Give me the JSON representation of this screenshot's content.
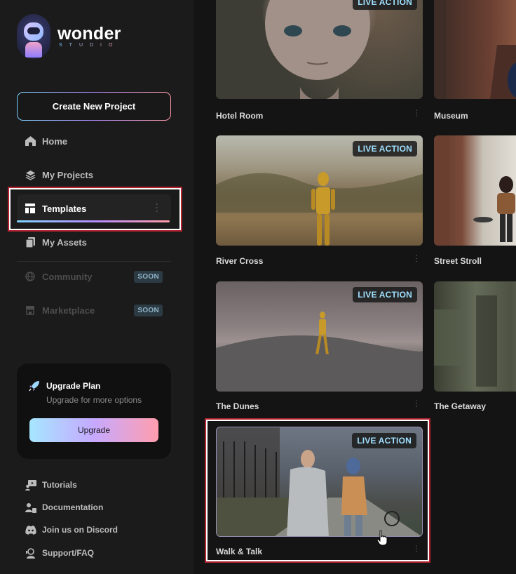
{
  "brand": {
    "name": "wonder",
    "sub": "STUDIO"
  },
  "sidebar": {
    "create_label": "Create New Project",
    "nav": [
      {
        "label": "Home",
        "icon": "home-icon"
      },
      {
        "label": "My Projects",
        "icon": "layers-icon"
      },
      {
        "label": "Templates",
        "icon": "template-icon",
        "active": true
      },
      {
        "label": "My Assets",
        "icon": "assets-icon"
      }
    ],
    "disabled_nav": [
      {
        "label": "Community",
        "badge": "SOON",
        "icon": "globe-icon"
      },
      {
        "label": "Marketplace",
        "badge": "SOON",
        "icon": "store-icon"
      }
    ],
    "upgrade": {
      "title": "Upgrade Plan",
      "subtitle": "Upgrade for more options",
      "button": "Upgrade"
    },
    "footer": [
      {
        "label": "Tutorials",
        "icon": "tutorial-icon"
      },
      {
        "label": "Documentation",
        "icon": "documentation-icon"
      },
      {
        "label": "Join us on Discord",
        "icon": "discord-icon"
      },
      {
        "label": "Support/FAQ",
        "icon": "support-icon"
      }
    ]
  },
  "templates": [
    {
      "title": "Hotel Room",
      "badge": "LIVE ACTION"
    },
    {
      "title": "Museum",
      "badge": ""
    },
    {
      "title": "River Cross",
      "badge": "LIVE ACTION"
    },
    {
      "title": "Street Stroll",
      "badge": ""
    },
    {
      "title": "The Dunes",
      "badge": "LIVE ACTION"
    },
    {
      "title": "The Getaway",
      "badge": ""
    },
    {
      "title": "Walk & Talk",
      "badge": "LIVE ACTION"
    }
  ],
  "colors": {
    "accent_gradient": [
      "#80d4ff",
      "#b48cff",
      "#ff9aa8"
    ],
    "highlight": "#b3222e",
    "badge_text": "#9fe0ff"
  }
}
